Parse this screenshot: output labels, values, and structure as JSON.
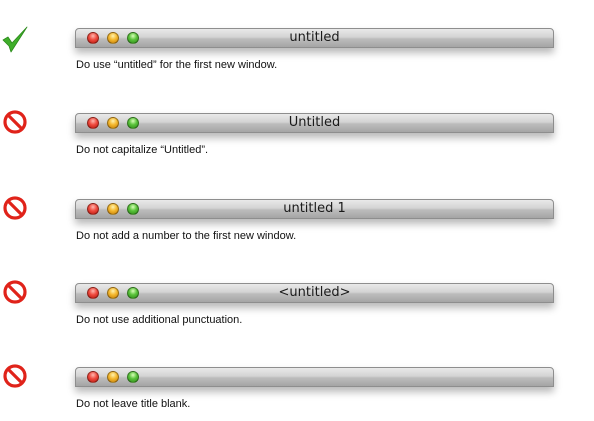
{
  "colors": {
    "check": "#3fae2a",
    "prohibit": "#e0231a"
  },
  "examples": [
    {
      "verdict_icon": "checkmark-icon",
      "window_title": "untitled",
      "caption": "Do use “untitled” for the first new window."
    },
    {
      "verdict_icon": "prohibited-icon",
      "window_title": "Untitled",
      "caption": "Do not capitalize “Untitled”."
    },
    {
      "verdict_icon": "prohibited-icon",
      "window_title": "untitled 1",
      "caption": "Do not add a number to the first new window."
    },
    {
      "verdict_icon": "prohibited-icon",
      "window_title": "<untitled>",
      "caption": "Do not use additional punctuation."
    },
    {
      "verdict_icon": "prohibited-icon",
      "window_title": "",
      "caption": "Do not leave title blank."
    }
  ]
}
